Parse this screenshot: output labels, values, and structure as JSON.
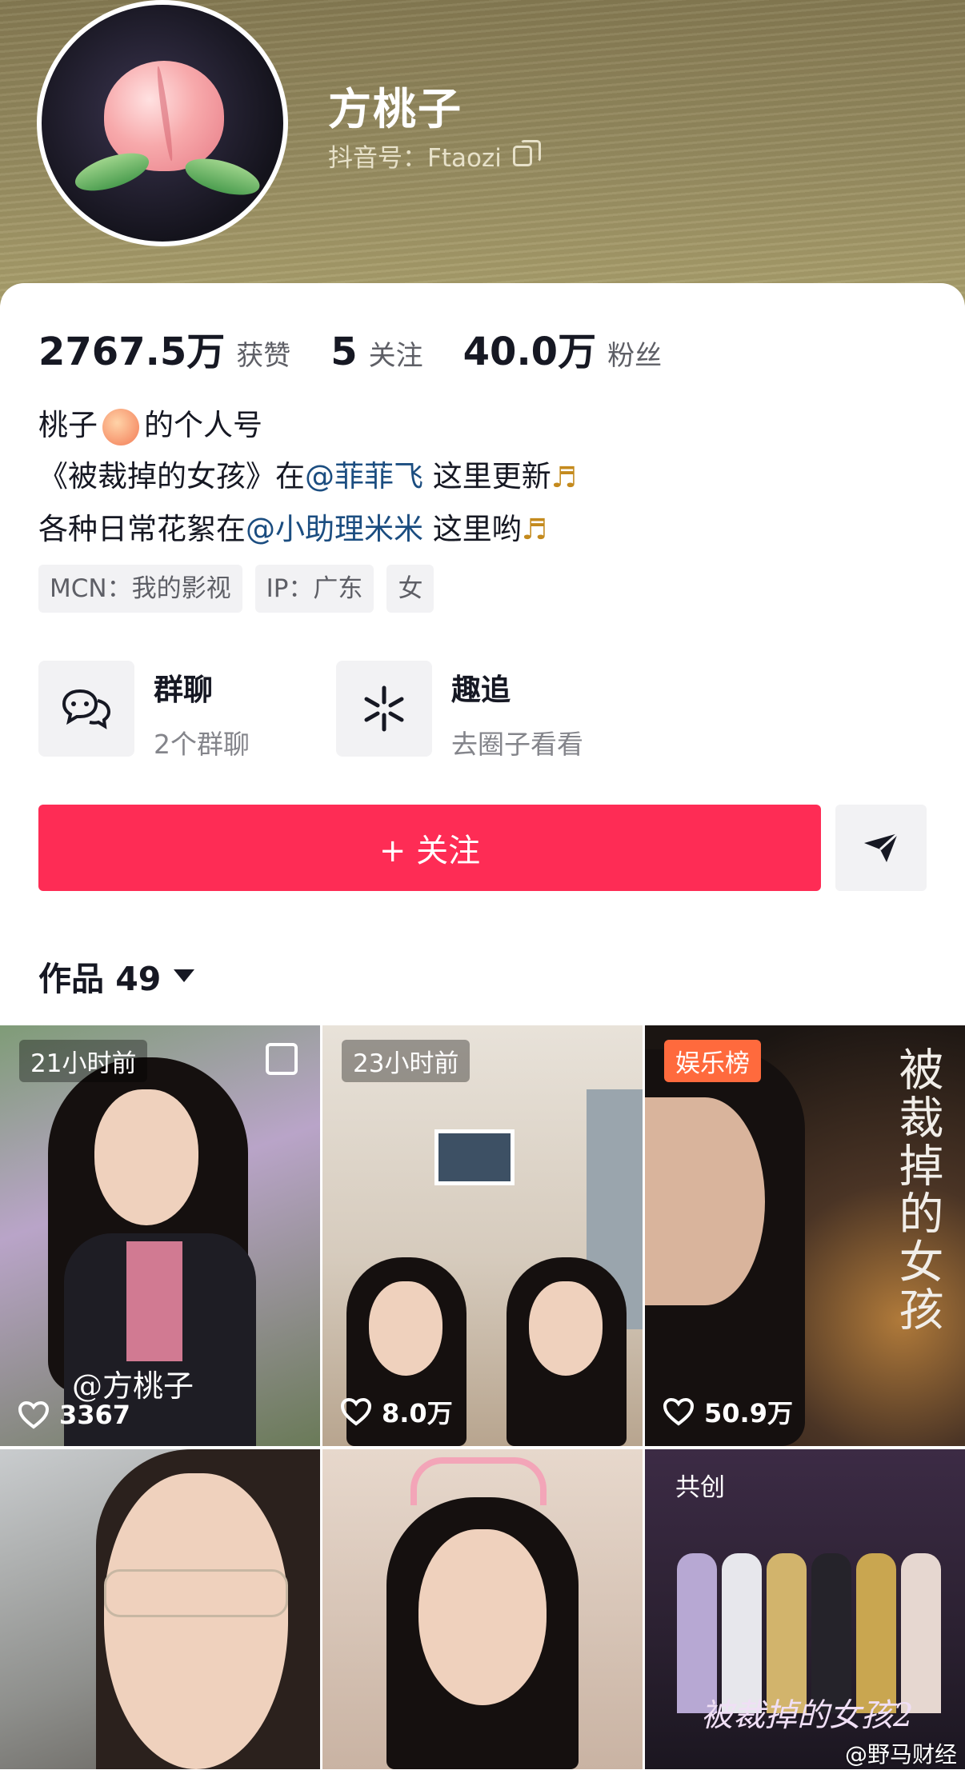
{
  "profile": {
    "name": "方桃子",
    "id_text": "抖音号：Ftaozi"
  },
  "stats": [
    {
      "value": "2767.5万",
      "label": "获赞"
    },
    {
      "value": "5",
      "label": "关注"
    },
    {
      "value": "40.0万",
      "label": "粉丝"
    }
  ],
  "bio": {
    "line1_a": "桃子",
    "line1_b": "的个人号",
    "line2_a": "《被裁掉的女孩》在",
    "line2_mention": "@菲菲飞",
    "line2_b": "这里更新",
    "line3_a": "各种日常花絮在",
    "line3_mention": "@小助理米米",
    "line3_b": "这里哟"
  },
  "tags": [
    "MCN：我的影视",
    "IP：广东",
    "女"
  ],
  "features": [
    {
      "title": "群聊",
      "subtitle": "2个群聊",
      "icon": "chat-bubbles-icon"
    },
    {
      "title": "趣追",
      "subtitle": "去圈子看看",
      "icon": "sparkle-icon"
    }
  ],
  "actions": {
    "follow_label": "+ 关注",
    "share_icon": "send-icon"
  },
  "works": {
    "label": "作品 49"
  },
  "videos": [
    {
      "badge": "21小时前",
      "likes": "3367",
      "overlay": "@方桃子"
    },
    {
      "badge": "23小时前",
      "likes": "8.0万",
      "overlay": ""
    },
    {
      "badge": "娱乐榜",
      "likes": "50.9万",
      "overlay": "被裁掉的女孩"
    },
    {
      "badge": "",
      "likes": "",
      "overlay": ""
    },
    {
      "badge": "",
      "likes": "",
      "overlay": ""
    },
    {
      "badge": "共创",
      "likes": "",
      "overlay": "被裁掉的女孩2"
    }
  ],
  "watermark": "@野马财经",
  "colors": {
    "accent": "#fe2c55",
    "mention": "#1b4d80",
    "entertainment_badge": "#ff6a3d"
  }
}
